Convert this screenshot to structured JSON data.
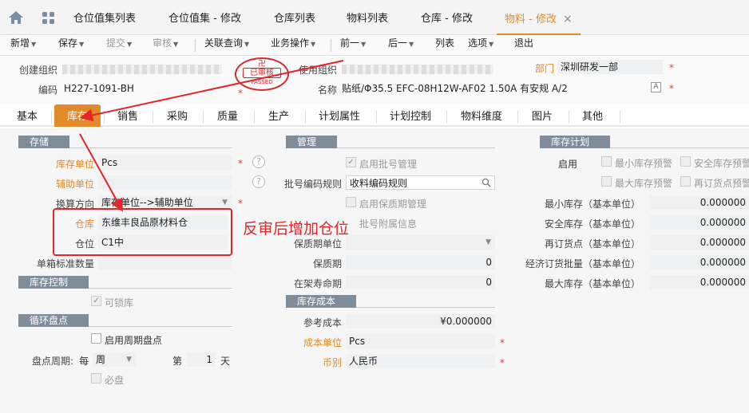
{
  "tabs": {
    "items": [
      "仓位值集列表",
      "仓位值集 - 修改",
      "仓库列表",
      "物料列表",
      "仓库 - 修改",
      "物料 - 修改"
    ],
    "close": "×"
  },
  "toolbar": {
    "new": "新增",
    "save": "保存",
    "submit": "提交",
    "audit": "审核",
    "related_query": "关联查询",
    "business_ops": "业务操作",
    "prev": "前一",
    "next": "后一",
    "list": "列表",
    "options": "选项",
    "exit": "退出"
  },
  "header": {
    "create_org_label": "创建组织",
    "use_org_label": "使用组织",
    "dept_label": "部门",
    "dept_value": "深圳研发一部",
    "code_label": "编码",
    "code_value": "H227-1091-BH",
    "name_label": "名称",
    "name_value": "贴纸/Φ35.5 EFC-08H12W-AF02 1.50A 有安规  A/2",
    "stamp_top": "已审核",
    "stamp_bottom": "PASSED"
  },
  "form_tabs": [
    "基本",
    "库存",
    "销售",
    "采购",
    "质量",
    "生产",
    "计划属性",
    "计划控制",
    "物料维度",
    "图片",
    "其他"
  ],
  "storage": {
    "title": "存储",
    "unit_label": "库存单位",
    "unit_value": "Pcs",
    "aux_unit_label": "辅助单位",
    "conversion_label": "换算方向",
    "conversion_value": "库存单位-->辅助单位",
    "warehouse_label": "仓库",
    "warehouse_value": "东维丰良品原材料仓",
    "location_label": "仓位",
    "location_value": "C1中",
    "box_qty_label": "单箱标准数量"
  },
  "stock_control": {
    "title": "库存控制",
    "lockable": "可锁库"
  },
  "cycle_count": {
    "title": "循环盘点",
    "enable": "启用周期盘点",
    "period_label": "盘点周期:",
    "every": "每",
    "period_unit": "周",
    "nth": "第",
    "nth_value": "1",
    "day": "天",
    "required": "必盘"
  },
  "management": {
    "title": "管理",
    "batch_mgmt": "启用批号管理",
    "batch_rule_label": "批号编码规则",
    "batch_rule_value": "收料编码规则",
    "shelf_life_mgmt": "启用保质期管理",
    "batch_extra": "批号附属信息",
    "shelf_unit_label": "保质期单位",
    "shelf_life_label": "保质期",
    "shelf_life_value": "0",
    "shelf_days_label": "在架寿命期",
    "shelf_days_value": "0"
  },
  "inventory_cost": {
    "title": "库存成本",
    "ref_cost_label": "参考成本",
    "ref_cost_value": "¥0.000000",
    "cost_unit_label": "成本单位",
    "cost_unit_value": "Pcs",
    "currency_label": "币别",
    "currency_value": "人民币"
  },
  "inventory_plan": {
    "title": "库存计划",
    "enable_label": "启用",
    "min_warn": "最小库存预警",
    "safe_warn": "安全库存预警",
    "max_warn": "最大库存预警",
    "reorder_warn": "再订货点预警",
    "rows": [
      {
        "label": "最小库存（基本单位）",
        "value": "0.000000"
      },
      {
        "label": "安全库存（基本单位）",
        "value": "0.000000"
      },
      {
        "label": "再订货点（基本单位）",
        "value": "0.000000"
      },
      {
        "label": "经济订货批量（基本单位）",
        "value": "0.000000"
      },
      {
        "label": "最大库存（基本单位）",
        "value": "0.000000"
      }
    ]
  },
  "annotation": {
    "text": "反审后增加仓位"
  },
  "colors": {
    "accent": "#e38a2a",
    "section": "#7f8c99",
    "annotation": "#e6252a",
    "required": "#e4393c"
  }
}
